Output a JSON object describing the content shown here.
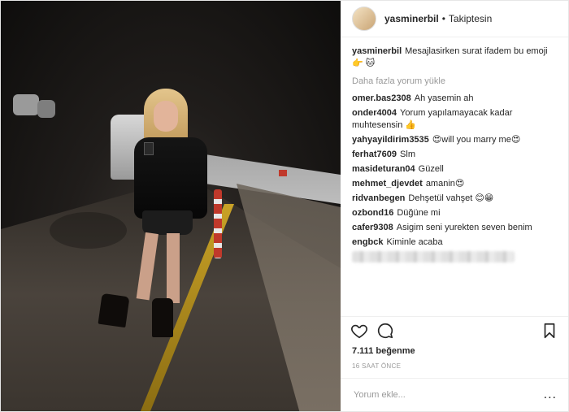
{
  "header": {
    "username": "yasminerbil",
    "separator": "•",
    "follow_status": "Takiptesin"
  },
  "caption": {
    "username": "yasminerbil",
    "text": "Mesajlasirken surat ifadem bu emoji👉 🐱"
  },
  "load_more": "Daha fazla yorum yükle",
  "comments": [
    {
      "username": "omer.bas2308",
      "text": "Ah yasemin ah"
    },
    {
      "username": "onder4004",
      "text": "Yorum yapılamayacak kadar muhtesensin 👍"
    },
    {
      "username": "yahyayildirim3535",
      "text": "😍will you marry me😍"
    },
    {
      "username": "ferhat7609",
      "text": "Slm"
    },
    {
      "username": "masideturan04",
      "text": "Güzell"
    },
    {
      "username": "mehmet_djevdet",
      "text": "amanin😍"
    },
    {
      "username": "ridvanbegen",
      "text": "Dehşetül vahşet 😊😁"
    },
    {
      "username": "ozbond16",
      "text": "Düğüne mi"
    },
    {
      "username": "cafer9308",
      "text": "Asigim seni yurekten seven benim"
    },
    {
      "username": "engbck",
      "text": "Kiminle acaba"
    }
  ],
  "icons": {
    "like": "heart-icon",
    "comment": "comment-icon",
    "save": "bookmark-icon",
    "options": "more-options-icon"
  },
  "likes": "7.111 beğenme",
  "timestamp": "16 SAAT ÖNCE",
  "add_comment": {
    "placeholder": "Yorum ekle...",
    "more_label": "..."
  }
}
